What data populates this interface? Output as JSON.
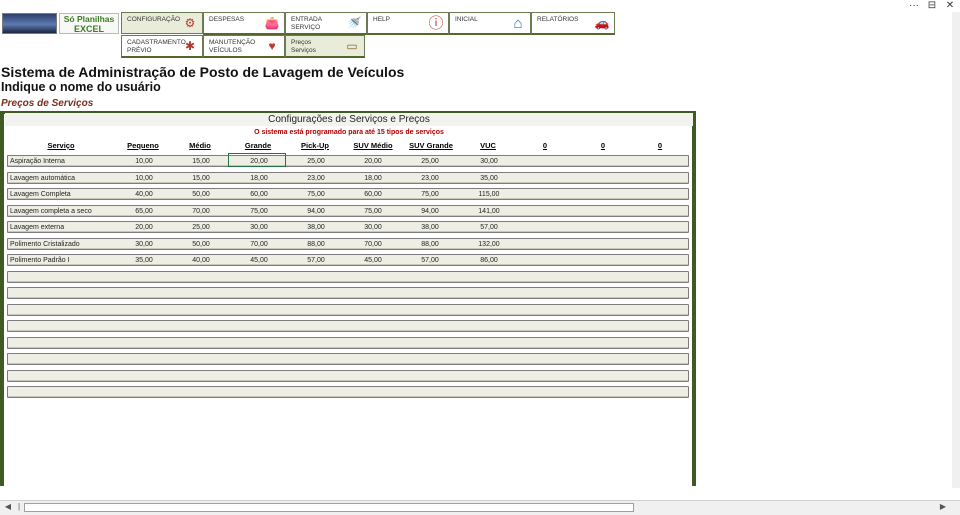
{
  "window": {
    "controls": [
      {
        "name": "more-icon",
        "glyph": "···"
      },
      {
        "name": "restore-icon",
        "glyph": "⊟"
      },
      {
        "name": "close-icon",
        "glyph": "✕"
      }
    ]
  },
  "logo": {
    "line1": "Só Planilhas",
    "line2": "EXCEL"
  },
  "nav": {
    "row1": [
      {
        "label": "CONFIGURAÇÃO",
        "icon": "sliders-icon",
        "glyph": "⚙"
      },
      {
        "label": "DESPESAS",
        "icon": "wallet-icon",
        "glyph": "👛"
      },
      {
        "label": "ENTRADA SERVIÇO",
        "icon": "car-wash-icon",
        "glyph": "🚿"
      },
      {
        "label": "HELP",
        "icon": "info-icon",
        "glyph": "ⓘ"
      },
      {
        "label": "INICIAL",
        "icon": "home-icon",
        "glyph": "⌂"
      },
      {
        "label": "RELATÓRIOS",
        "icon": "car-report-icon",
        "glyph": "🚗"
      }
    ],
    "row2": [
      {
        "label": "CADASTRAMENTO PRÉVIO",
        "icon": "brain-icon",
        "glyph": "✱"
      },
      {
        "label": "MANUTENÇÃO VEÍCULOS",
        "icon": "car-heart-icon",
        "glyph": "♥"
      },
      {
        "label": "Preços Serviços",
        "icon": "money-icon",
        "glyph": "▭"
      }
    ]
  },
  "header": {
    "system_title": "Sistema de Administração de Posto de Lavagem de Veículos",
    "user_name": "Indique o nome do usuário",
    "section": "Preços de Serviços"
  },
  "panel": {
    "title": "Configurações de Serviços e Preços",
    "note": "O sistema está programado para até 15 tipos de serviços"
  },
  "table": {
    "columns": [
      "Serviço",
      "Pequeno",
      "Médio",
      "Grande",
      "Pick-Up",
      "SUV Médio",
      "SUV Grande",
      "VUC",
      "0",
      "0",
      "0"
    ],
    "rows": [
      [
        "Aspiração Interna",
        "10,00",
        "15,00",
        "20,00",
        "25,00",
        "20,00",
        "25,00",
        "30,00"
      ],
      [
        "Lavagem automática",
        "10,00",
        "15,00",
        "18,00",
        "23,00",
        "18,00",
        "23,00",
        "35,00"
      ],
      [
        "Lavagem Completa",
        "40,00",
        "50,00",
        "60,00",
        "75,00",
        "60,00",
        "75,00",
        "115,00"
      ],
      [
        "Lavagem completa a seco",
        "65,00",
        "70,00",
        "75,00",
        "94,00",
        "75,00",
        "94,00",
        "141,00"
      ],
      [
        "Lavagem externa",
        "20,00",
        "25,00",
        "30,00",
        "38,00",
        "30,00",
        "38,00",
        "57,00"
      ],
      [
        "Polimento Cristalizado",
        "30,00",
        "50,00",
        "70,00",
        "88,00",
        "70,00",
        "88,00",
        "132,00"
      ],
      [
        "Polimento Padrão I",
        "35,00",
        "40,00",
        "45,00",
        "57,00",
        "45,00",
        "57,00",
        "86,00"
      ],
      [
        "",
        "",
        "",
        "",
        "",
        "",
        "",
        ""
      ],
      [
        "",
        "",
        "",
        "",
        "",
        "",
        "",
        ""
      ],
      [
        "",
        "",
        "",
        "",
        "",
        "",
        "",
        ""
      ],
      [
        "",
        "",
        "",
        "",
        "",
        "",
        "",
        ""
      ],
      [
        "",
        "",
        "",
        "",
        "",
        "",
        "",
        ""
      ],
      [
        "",
        "",
        "",
        "",
        "",
        "",
        "",
        ""
      ],
      [
        "",
        "",
        "",
        "",
        "",
        "",
        "",
        ""
      ],
      [
        "",
        "",
        "",
        "",
        "",
        "",
        "",
        ""
      ]
    ]
  }
}
